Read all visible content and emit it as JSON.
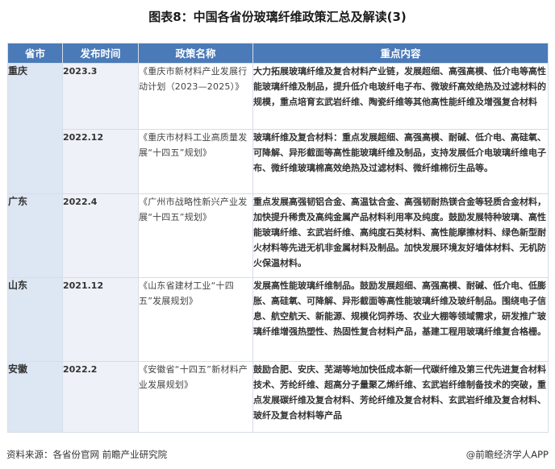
{
  "title": "图表8：中国各省份玻璃纤维政策汇总及解读(3)",
  "headers": [
    "省市",
    "发布时间",
    "政策名称",
    "重点内容"
  ],
  "rows": [
    {
      "province": "",
      "date": "2023.3",
      "policy": "《重庆市新材料产业发展行动计划（2023—2025）》",
      "content": "大力拓展玻璃纤维及复合材料产业链，发展超细、高强高模、低介电等高性能玻璃纤维及制品，提升低介电玻纤电子布、微玻纤高效绝热及过滤材料的规模，重点培育玄武岩纤维、陶瓷纤维等其他高性能纤维及增强复合材料"
    },
    {
      "province": "重庆",
      "date": "2022.12",
      "policy": "《重庆市材料工业高质量发展“十四五”规划》",
      "content": "玻璃纤维及复合材料：重点发展超细、高强高模、耐碱、低介电、高硅氧、可降解、异形截面等高性能玻璃纤维及制品，支持发展低介电玻璃纤维电子布、微纤维玻璃棉高效绝热及过滤材料、微纤维棉衍生品等。"
    },
    {
      "province": "广东",
      "date": "2022.4",
      "policy": "《广州市战略性新兴产业发展“十四五”规划》",
      "content": "重点发展高强韧铝合金、高温钛合金、高强韧耐热镁合金等轻质合金材料，加快提升稀贵及高纯金属产品材料利用率及纯度。鼓励发展特种玻璃、高性能玻璃纤维、玄武岩纤维、高纯度石英材料、高性能摩擦材料、绿色新型耐火材料等先进无机非金属材料及制品。加快发展环境友好墙体材料、无机防火保温材料。"
    },
    {
      "province": "山东",
      "date": "2021.12",
      "policy": "《山东省建材工业“十四五”发展规划》",
      "content": "发展高性能玻璃纤维制品。鼓励发展超细、高强高模、耐碱、低介电、低膨胀、高硅氧、可降解、异形截面等高性能玻璃纤维及玻纤制品。围绕电子信息、航空航天、新能源、规模化饲养场、农业大棚等领域需求，研发推广玻璃纤维增强热塑性、热固性复合材料产品，基建工程用玻璃纤维复合格栅。"
    },
    {
      "province": "安徽",
      "date": "2022.2",
      "policy": "《安徽省“十四五”新材料产业发展规划》",
      "content": "鼓励合肥、安庆、芜湖等地加快低成本新一代碳纤维及第三代先进复合材料技术、芳纶纤维、超高分子量聚乙烯纤维、玄武岩纤维制备技术的突破，重点发展碳纤维及复合材料、芳纶纤维及复合材料、玄武岩纤维及复合材料、玻纤及复合材料等产品"
    }
  ],
  "footer": {
    "source": "资料来源：各省份官网 前瞻产业研究院",
    "brand": "@前瞻经济学人APP"
  }
}
